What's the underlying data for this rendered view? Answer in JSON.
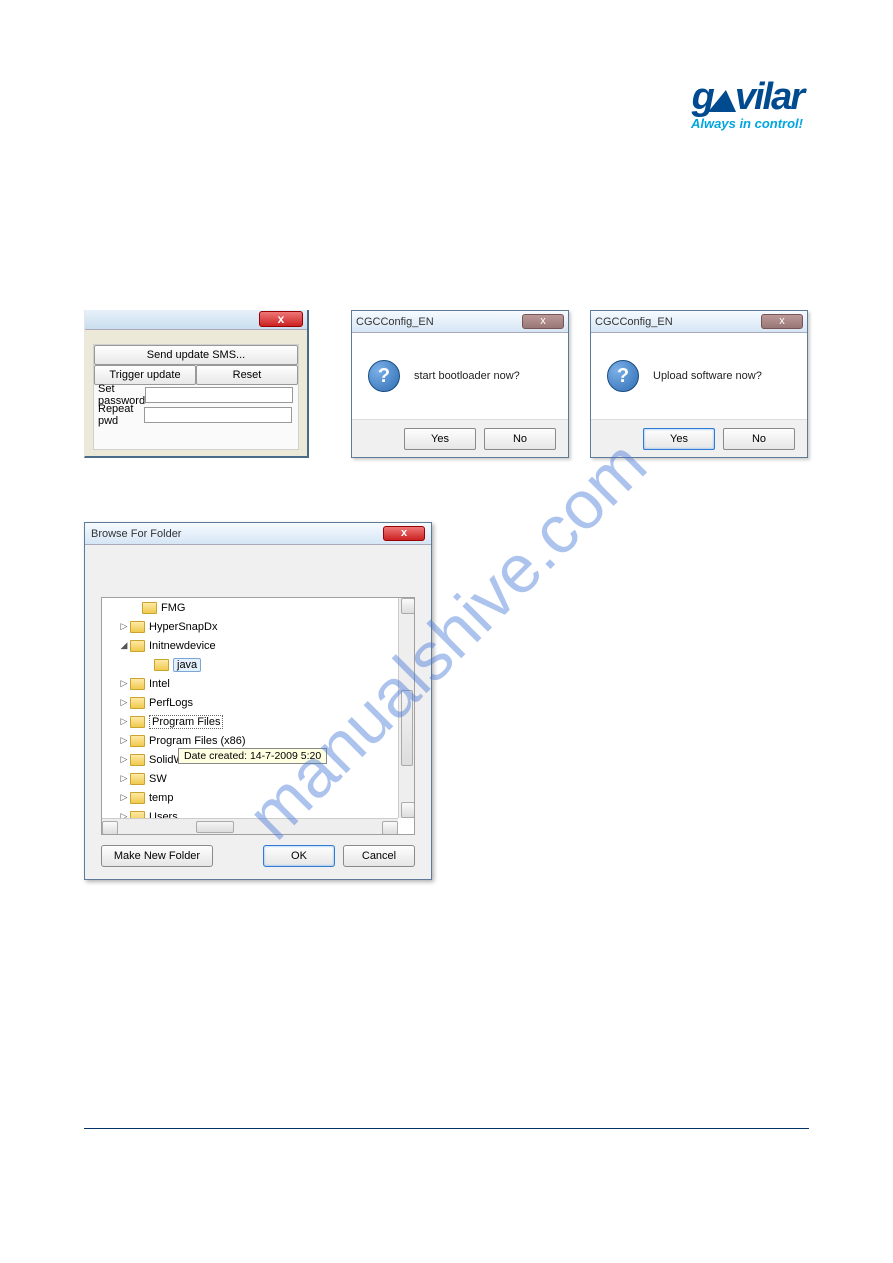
{
  "logo": {
    "text": "gAvilar",
    "tagline": "Always in control!"
  },
  "watermark": "manualshive.com",
  "panel1": {
    "send_sms": "Send update SMS...",
    "trigger": "Trigger update",
    "reset": "Reset",
    "set_pwd": "Set password",
    "repeat_pwd": "Repeat pwd",
    "setpwd_val": "",
    "repeatpwd_val": ""
  },
  "dlg1": {
    "title": "CGCConfig_EN",
    "msg": "start bootloader now?",
    "yes": "Yes",
    "no": "No"
  },
  "dlg2": {
    "title": "CGCConfig_EN",
    "msg": "Upload software now?",
    "yes": "Yes",
    "no": "No"
  },
  "browse": {
    "title": "Browse For Folder",
    "tooltip": "Date created: 14-7-2009 5:20",
    "make_new": "Make New Folder",
    "ok": "OK",
    "cancel": "Cancel",
    "tree": [
      {
        "indent": 28,
        "exp": "",
        "name": "FMG",
        "sel": false
      },
      {
        "indent": 16,
        "exp": "▷",
        "name": "HyperSnapDx",
        "sel": false
      },
      {
        "indent": 16,
        "exp": "◢",
        "name": "Initnewdevice",
        "sel": false
      },
      {
        "indent": 40,
        "exp": "",
        "name": "java",
        "sel": false,
        "hl": true
      },
      {
        "indent": 16,
        "exp": "▷",
        "name": "Intel",
        "sel": false
      },
      {
        "indent": 16,
        "exp": "▷",
        "name": "PerfLogs",
        "sel": false
      },
      {
        "indent": 16,
        "exp": "▷",
        "name": "Program Files",
        "sel": true
      },
      {
        "indent": 16,
        "exp": "▷",
        "name": "Program Files (x86)",
        "sel": false
      },
      {
        "indent": 16,
        "exp": "▷",
        "name": "SolidWorks",
        "sel": false
      },
      {
        "indent": 16,
        "exp": "▷",
        "name": "SW",
        "sel": false
      },
      {
        "indent": 16,
        "exp": "▷",
        "name": "temp",
        "sel": false
      },
      {
        "indent": 16,
        "exp": "▷",
        "name": "Users",
        "sel": false
      }
    ]
  }
}
